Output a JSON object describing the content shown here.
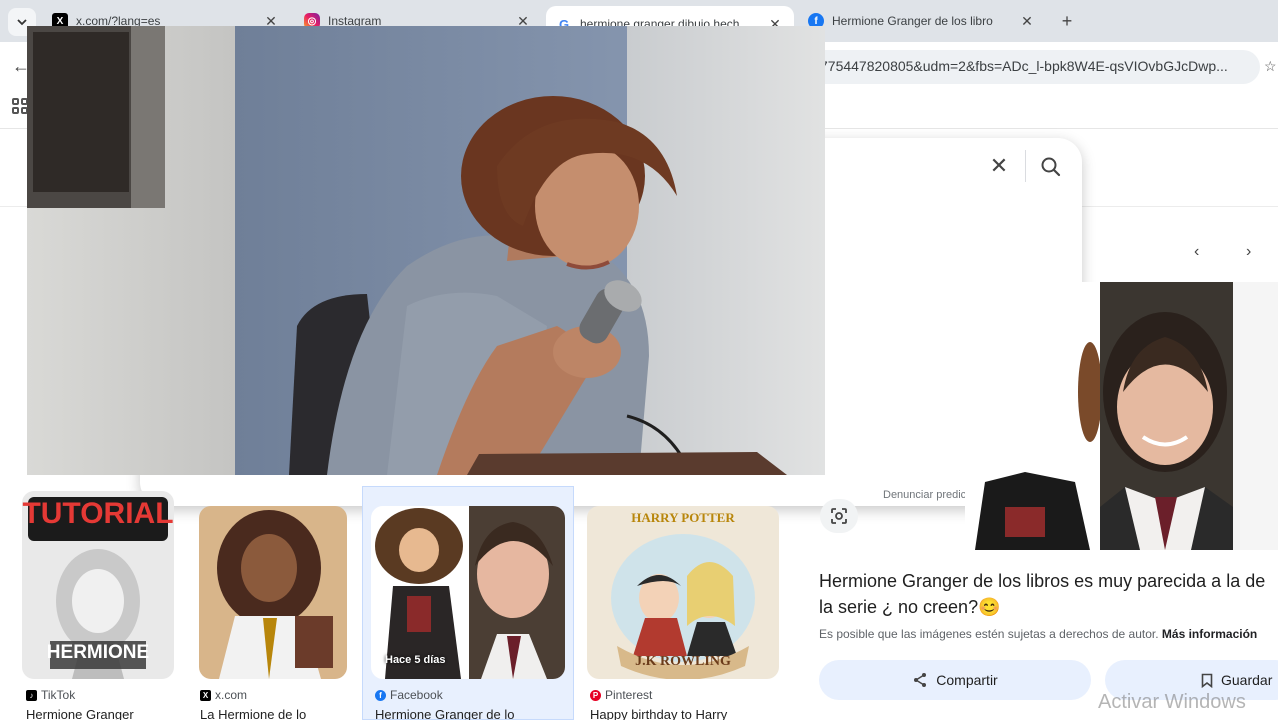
{
  "tabs": [
    {
      "title": "x.com/?lang=es",
      "favicon": "x-logo-icon"
    },
    {
      "title": "Instagram",
      "favicon": "instagram-icon"
    },
    {
      "title": "hermione granger dibujo hech",
      "favicon": "google-g-icon"
    },
    {
      "title": "Hermione Granger de los libro",
      "favicon": "facebook-icon"
    }
  ],
  "address_bar": {
    "url_visible": "775447820805&udm=2&fbs=ADc_l-bpk8W4E-qsVIOvbGJcDwp..."
  },
  "search": {
    "report_link": "Denunciar predicciones ofensivas"
  },
  "results": [
    {
      "thumb_text": "TUTORIAL",
      "thumb_label": "HERMIONE",
      "source": "TikTok",
      "caption": "Hermione Granger"
    },
    {
      "source": "x.com",
      "caption": "La Hermione de lo"
    },
    {
      "badge": "Hace 5 días",
      "source": "Facebook",
      "caption": "Hermione Granger de lo"
    },
    {
      "thumb_text": "HARRY POTTER",
      "thumb_label": "J.K ROWLING",
      "source": "Pinterest",
      "caption": "Happy birthday to Harry"
    }
  ],
  "detail": {
    "title": "Hermione Granger de los libros es muy parecida a la de la serie ¿ no creen?😊",
    "copyright_text": "Es posible que las imágenes estén sujetas a derechos de autor.",
    "more_info": "Más información",
    "share_label": "Compartir",
    "save_label": "Guardar"
  },
  "watermark": "Activar Windows",
  "colors": {
    "tabstrip": "#dfe3e8",
    "omnibox": "#eef1f4",
    "action_button": "#e8f0fe",
    "selected_card": "#e8f0fe"
  }
}
